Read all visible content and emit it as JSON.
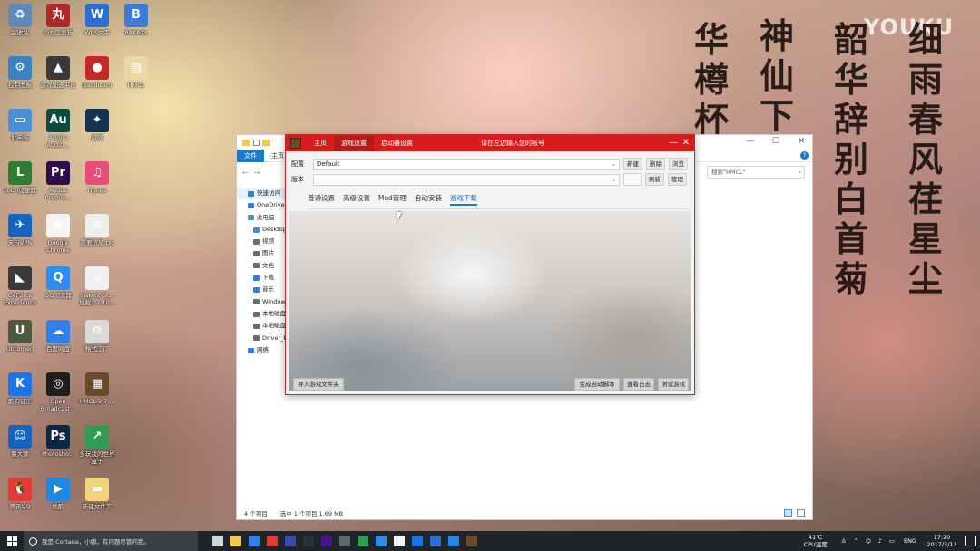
{
  "watermark": "YOUKU",
  "calligraphy": [
    "华樽杯",
    "神仙下",
    "韶华辞别白首菊",
    "细雨春风荏星尘"
  ],
  "desktop_icons": [
    {
      "label": "回收站",
      "color": "#5f8ab5",
      "glyph": "♻"
    },
    {
      "label": "小丸工具箱",
      "color": "#b02a2a",
      "glyph": "丸"
    },
    {
      "label": "WPS文字",
      "color": "#2b6fd6",
      "glyph": "W"
    },
    {
      "label": "BAKAXL",
      "color": "#3a7bd5",
      "glyph": "B"
    },
    {
      "label": "控制面板",
      "color": "#3b82c4",
      "glyph": "⚙"
    },
    {
      "label": "游戏加速平台",
      "color": "#3a3a3a",
      "glyph": "▲"
    },
    {
      "label": "Bandicam",
      "color": "#c62828",
      "glyph": "●"
    },
    {
      "label": "HMCL",
      "color": "#e8d9a8",
      "glyph": "▤"
    },
    {
      "label": "此电脑",
      "color": "#4a90d9",
      "glyph": "▭"
    },
    {
      "label": "Adobe Auditi...",
      "color": "#0b4c3f",
      "glyph": "Au"
    },
    {
      "label": "战网",
      "color": "#12324f",
      "glyph": "✦"
    },
    {
      "label": "LoCo加速器",
      "color": "#2e7d32",
      "glyph": "L"
    },
    {
      "label": "Adobe Premie...",
      "color": "#2a0d4a",
      "glyph": "Pr"
    },
    {
      "label": "iTunes",
      "color": "#e94c7c",
      "glyph": "♫"
    },
    {
      "label": "天行VPN",
      "color": "#1565c0",
      "glyph": "✈"
    },
    {
      "label": "Google Chrome",
      "color": "#f4f4f4",
      "glyph": "◉"
    },
    {
      "label": "重要信息.txt",
      "color": "#eeeeee",
      "glyph": "≡"
    },
    {
      "label": "GeForce Experience",
      "color": "#3a3a3a",
      "glyph": "◣"
    },
    {
      "label": "QQ浏览器",
      "color": "#2d8cf0",
      "glyph": "Q"
    },
    {
      "label": "Instant-St... 加载1.7.10...",
      "color": "#f0f0f0",
      "glyph": "☕"
    },
    {
      "label": "Unturned",
      "color": "#4c5a3f",
      "glyph": "U"
    },
    {
      "label": "百度网盘",
      "color": "#2f80ed",
      "glyph": "☁"
    },
    {
      "label": "格式工厂",
      "color": "#d9d9d9",
      "glyph": "⚙"
    },
    {
      "label": "酷狗音乐",
      "color": "#1a73e8",
      "glyph": "K"
    },
    {
      "label": "Open Broadcast...",
      "color": "#1e1e1e",
      "glyph": "◎"
    },
    {
      "label": "HMCL-2.7....",
      "color": "#6b4a2b",
      "glyph": "▦"
    },
    {
      "label": "鲁大师",
      "color": "#1565c0",
      "glyph": "☺"
    },
    {
      "label": "Photosho...",
      "color": "#0a2746",
      "glyph": "Ps"
    },
    {
      "label": "多玩我的世界盒子",
      "color": "#2e9d4f",
      "glyph": "↗"
    },
    {
      "label": "腾讯QQ",
      "color": "#e53935",
      "glyph": "🐧"
    },
    {
      "label": "优酷",
      "color": "#1e88e5",
      "glyph": "▶"
    },
    {
      "label": "新建文件夹",
      "color": "#f2d27a",
      "glyph": "▬"
    }
  ],
  "explorer": {
    "ribbon_tabs": [
      "文件",
      "主页"
    ],
    "search_placeholder": "搜索\"HMCL\"",
    "nav_items": [
      {
        "label": "快速访问",
        "color": "#2f80ed"
      },
      {
        "label": "OneDrive",
        "color": "#2f80ed"
      },
      {
        "label": "此电脑",
        "color": "#4a90d9"
      },
      {
        "label": "Desktop",
        "color": "#3d8de0"
      },
      {
        "label": "视频",
        "color": "#6d6d6d"
      },
      {
        "label": "图片",
        "color": "#6d6d6d"
      },
      {
        "label": "文档",
        "color": "#6d6d6d"
      },
      {
        "label": "下载",
        "color": "#2f80ed"
      },
      {
        "label": "音乐",
        "color": "#2f80ed"
      },
      {
        "label": "Windows",
        "color": "#6d6d6d"
      },
      {
        "label": "本地磁盘",
        "color": "#6d6d6d"
      },
      {
        "label": "本地磁盘",
        "color": "#6d6d6d"
      },
      {
        "label": "Driver_B",
        "color": "#6d6d6d"
      },
      {
        "label": "网络",
        "color": "#2f80ed"
      }
    ],
    "status": [
      "4 个项目",
      "选中 1 个项目  1.69 MB"
    ]
  },
  "launcher": {
    "tabs": [
      "主页",
      "游戏设置",
      "启动器设置"
    ],
    "title": "请在左边输入您的账号",
    "profile_label": "配置",
    "profile_value": "Default",
    "version_label": "版本",
    "version_value": "",
    "profile_buttons": [
      "新建",
      "删除",
      "浏览"
    ],
    "version_buttons": [
      "",
      "刷新",
      "管理"
    ],
    "subtabs": [
      "普通设置",
      "高级设置",
      "Mod管理",
      "自动安装",
      "游戏下载"
    ],
    "active_subtab": 4,
    "bottom_left_button": "导入游戏文件夹",
    "bottom_right_buttons": [
      "生成启动脚本",
      "查看日志",
      "测试游戏"
    ]
  },
  "taskbar": {
    "cortana_placeholder": "我是 Cortana，小娜。有问题尽管问我。",
    "apps": [
      {
        "name": "task-view",
        "color": "#cfd8dc"
      },
      {
        "name": "file-explorer",
        "color": "#f2c94c"
      },
      {
        "name": "baidu-netdisk",
        "color": "#2f80ed"
      },
      {
        "name": "qq",
        "color": "#e53935"
      },
      {
        "name": "unknown-app",
        "color": "#3949ab"
      },
      {
        "name": "obs",
        "color": "#263238"
      },
      {
        "name": "premiere",
        "color": "#4a148c"
      },
      {
        "name": "geforce",
        "color": "#5d6b6b"
      },
      {
        "name": "minecraft-box",
        "color": "#2e9d4f"
      },
      {
        "name": "qq-browser",
        "color": "#2d8cf0"
      },
      {
        "name": "chrome",
        "color": "#f4f4f4"
      },
      {
        "name": "kugou",
        "color": "#1a73e8"
      },
      {
        "name": "wps",
        "color": "#2b6fd6"
      },
      {
        "name": "youku",
        "color": "#1e88e5"
      },
      {
        "name": "hmcl",
        "color": "#6b4a2b"
      }
    ],
    "temperature": "41℃",
    "temperature_label": "CPU温度",
    "language": "ENG",
    "time": "17:20",
    "date": "2017/3/12"
  }
}
